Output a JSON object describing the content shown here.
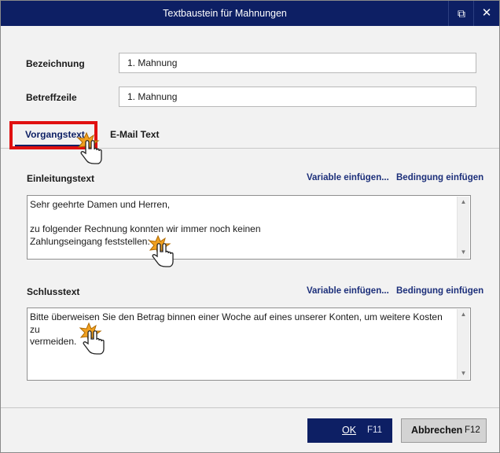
{
  "window": {
    "title": "Textbaustein für Mahnungen",
    "popout_icon": "popout-icon",
    "close_icon": "close-icon",
    "close_glyph": "✕",
    "popout_glyph": "⧉"
  },
  "form": {
    "bezeichnung_label": "Bezeichnung",
    "bezeichnung_value": "1. Mahnung",
    "betreffzeile_label": "Betreffzeile",
    "betreffzeile_value": "1. Mahnung"
  },
  "tabs": [
    {
      "label": "Vorgangstext",
      "active": true
    },
    {
      "label": "E-Mail Text",
      "active": false
    }
  ],
  "einleitung": {
    "label": "Einleitungstext",
    "variable_link": "Variable einfügen...",
    "bedingung_link": "Bedingung einfügen",
    "text": "Sehr geehrte Damen und Herren,\n\nzu folgender Rechnung konnten wir immer noch keinen\nZahlungseingang feststellen:"
  },
  "schluss": {
    "label": "Schlusstext",
    "variable_link": "Variable einfügen...",
    "bedingung_link": "Bedingung einfügen",
    "text": "Bitte überweisen Sie den Betrag binnen einer Woche auf eines unserer Konten, um weitere Kosten zu\nvermeiden."
  },
  "scrollbar": {
    "up_glyph": "▲",
    "down_glyph": "▼"
  },
  "buttons": {
    "ok_label": "OK",
    "ok_key": "F11",
    "cancel_label": "Abbrechen",
    "cancel_key": "F12"
  },
  "colors": {
    "titlebar": "#0d1f64",
    "accent": "#0d1f64",
    "highlight": "#e01010",
    "link": "#1c2f7a"
  }
}
